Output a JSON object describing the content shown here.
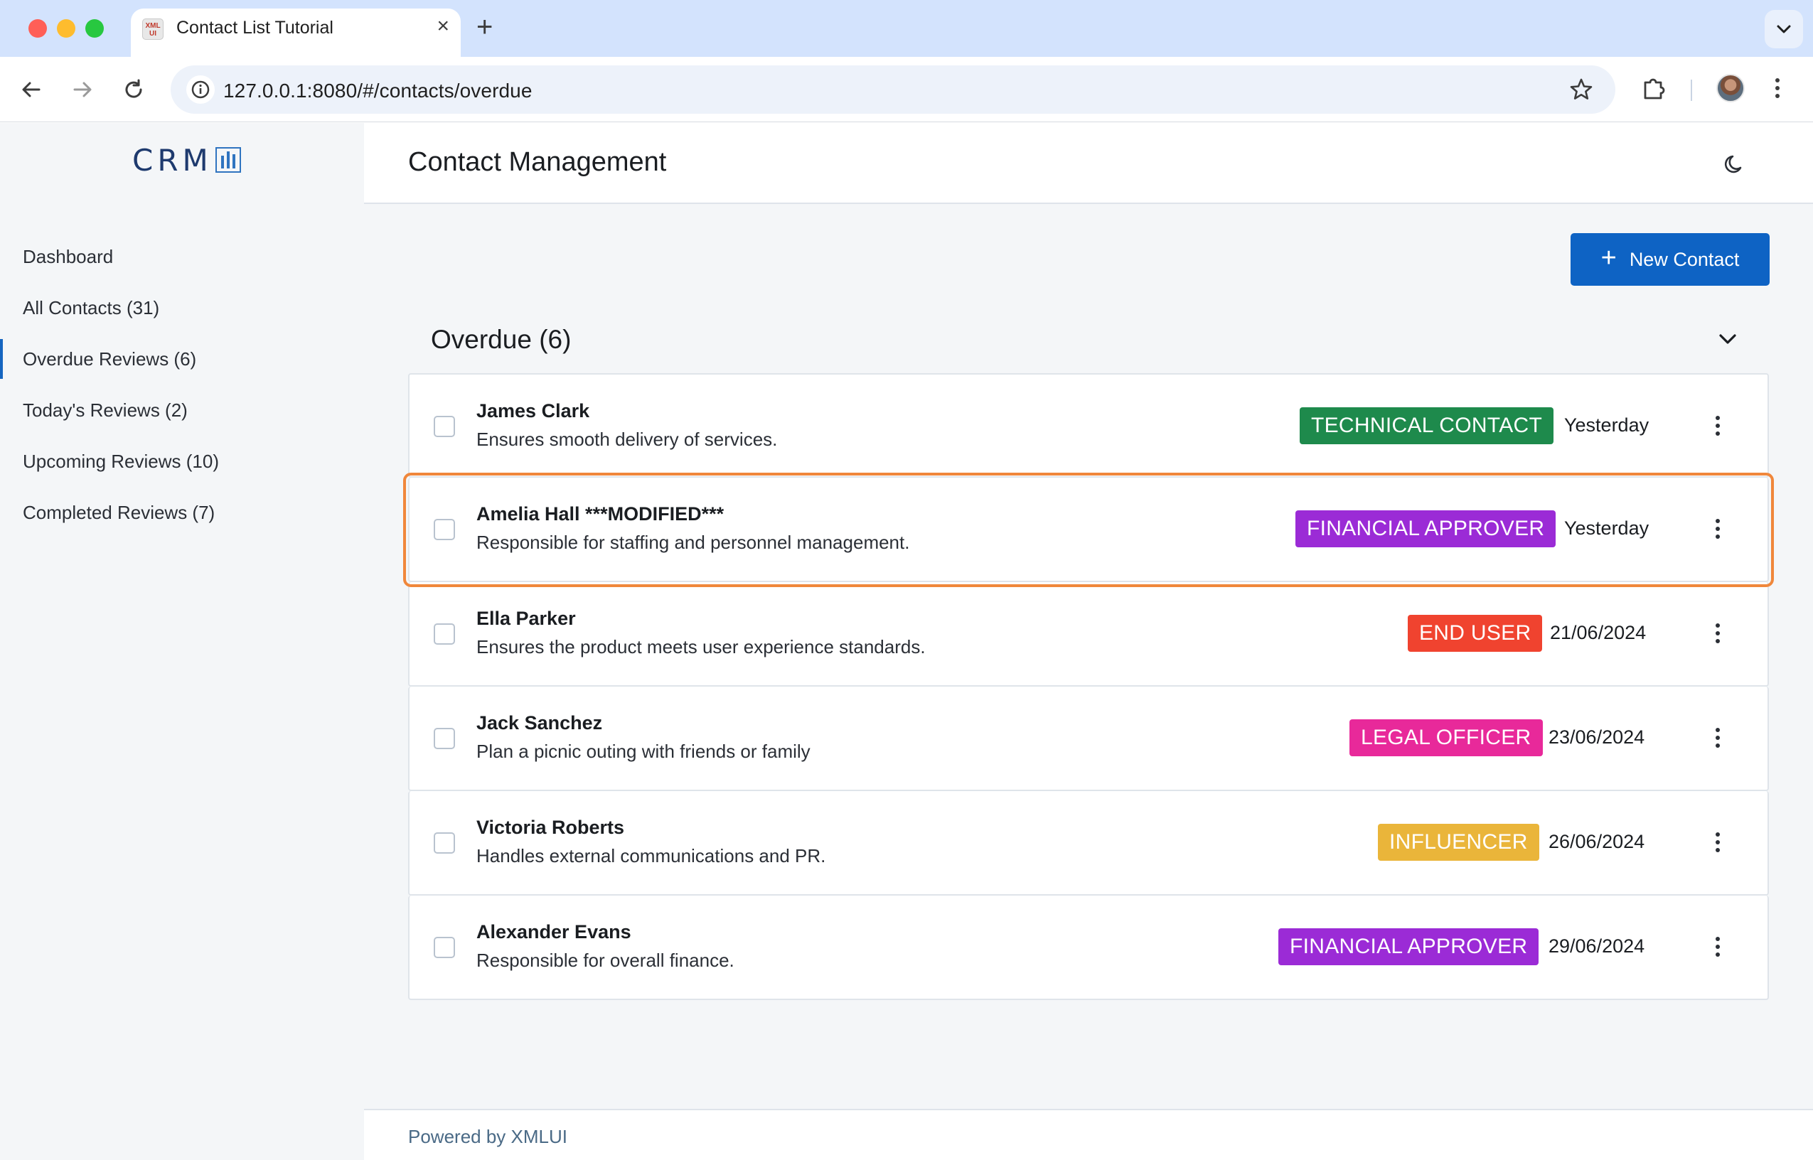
{
  "browser": {
    "tab_title": "Contact List Tutorial",
    "favicon_text": "XML UI",
    "url": "127.0.0.1:8080/#/contacts/overdue"
  },
  "app": {
    "logo": "CRM",
    "page_title": "Contact Management",
    "new_contact_label": "New Contact",
    "section_title": "Overdue (6)",
    "footer": "Powered by XMLUI"
  },
  "sidebar": {
    "items": [
      {
        "label": "Dashboard"
      },
      {
        "label": "All Contacts (31)"
      },
      {
        "label": "Overdue Reviews (6)"
      },
      {
        "label": "Today's Reviews (2)"
      },
      {
        "label": "Upcoming Reviews (10)"
      },
      {
        "label": "Completed Reviews (7)"
      }
    ],
    "active_index": 2
  },
  "contacts": [
    {
      "name": "James Clark",
      "description": "Ensures smooth delivery of services.",
      "badge": "TECHNICAL CONTACT",
      "badge_color": "#1e8a4c",
      "date": "Yesterday"
    },
    {
      "name": "Amelia Hall ***MODIFIED***",
      "description": "Responsible for staffing and personnel management.",
      "badge": "FINANCIAL APPROVER",
      "badge_color": "#9b2bd6",
      "date": "Yesterday"
    },
    {
      "name": "Ella Parker",
      "description": "Ensures the product meets user experience standards.",
      "badge": "END USER",
      "badge_color": "#f0432f",
      "date": "21/06/2024"
    },
    {
      "name": "Jack Sanchez",
      "description": "Plan a picnic outing with friends or family",
      "badge": "LEGAL OFFICER",
      "badge_color": "#e8299a",
      "date": "23/06/2024"
    },
    {
      "name": "Victoria Roberts",
      "description": "Handles external communications and PR.",
      "badge": "INFLUENCER",
      "badge_color": "#eab53a",
      "date": "26/06/2024"
    },
    {
      "name": "Alexander Evans",
      "description": "Responsible for overall finance.",
      "badge": "FINANCIAL APPROVER",
      "badge_color": "#9b2bd6",
      "date": "29/06/2024"
    }
  ],
  "colors": {
    "accent": "#0e63c4",
    "highlight_outline": "#f0873b"
  }
}
